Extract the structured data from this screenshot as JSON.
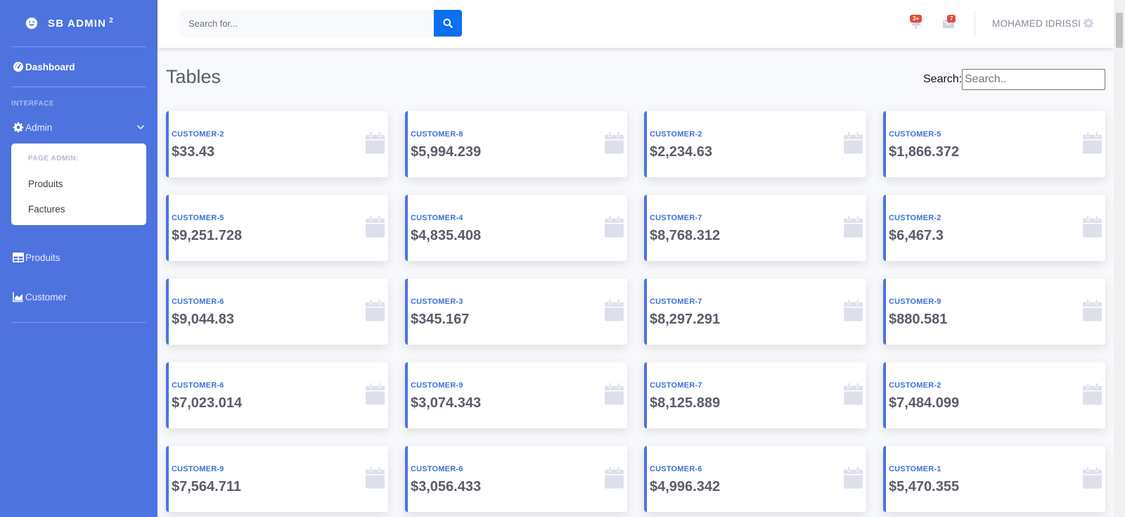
{
  "brand": {
    "title": "SB ADMIN",
    "superscript": "2"
  },
  "sidebar": {
    "dashboard_label": "Dashboard",
    "heading": "INTERFACE",
    "admin_label": "Admin",
    "collapse": {
      "header": "PAGE ADMIN:",
      "items": [
        {
          "label": "Produits"
        },
        {
          "label": "Factures"
        }
      ]
    },
    "produits_label": "Produits",
    "customer_label": "Customer"
  },
  "topbar": {
    "search_placeholder": "Search for...",
    "alerts_badge": "3+",
    "messages_badge": "7",
    "user_name": "MOHAMED IDRISSI"
  },
  "main": {
    "title": "Tables",
    "search_label": "Search:",
    "search_placeholder": "Search..",
    "cards": [
      {
        "label": "CUSTOMER-2",
        "value": "$33.43"
      },
      {
        "label": "CUSTOMER-8",
        "value": "$5,994.239"
      },
      {
        "label": "CUSTOMER-2",
        "value": "$2,234.63"
      },
      {
        "label": "CUSTOMER-5",
        "value": "$1,866.372"
      },
      {
        "label": "CUSTOMER-5",
        "value": "$9,251.728"
      },
      {
        "label": "CUSTOMER-4",
        "value": "$4,835.408"
      },
      {
        "label": "CUSTOMER-7",
        "value": "$8,768.312"
      },
      {
        "label": "CUSTOMER-2",
        "value": "$6,467.3"
      },
      {
        "label": "CUSTOMER-6",
        "value": "$9,044.83"
      },
      {
        "label": "CUSTOMER-3",
        "value": "$345.167"
      },
      {
        "label": "CUSTOMER-7",
        "value": "$8,297.291"
      },
      {
        "label": "CUSTOMER-9",
        "value": "$880.581"
      },
      {
        "label": "CUSTOMER-6",
        "value": "$7,023.014"
      },
      {
        "label": "CUSTOMER-9",
        "value": "$3,074.343"
      },
      {
        "label": "CUSTOMER-7",
        "value": "$8,125.889"
      },
      {
        "label": "CUSTOMER-2",
        "value": "$7,484.099"
      },
      {
        "label": "CUSTOMER-9",
        "value": "$7,564.711"
      },
      {
        "label": "CUSTOMER-6",
        "value": "$3,056.433"
      },
      {
        "label": "CUSTOMER-6",
        "value": "$4,996.342"
      },
      {
        "label": "CUSTOMER-1",
        "value": "$5,470.355"
      }
    ]
  },
  "colors": {
    "sidebar": "#4e73df",
    "accent": "#4e73df",
    "search_button": "#0b6ff0",
    "badge": "#e74a3b",
    "card_label": "#3b72d9"
  },
  "icons": {
    "brand": "laugh-wink-icon",
    "dashboard": "tachometer-icon",
    "admin": "gear-icon",
    "produits": "table-icon",
    "customer": "chart-area-icon",
    "alerts": "bell-icon",
    "messages": "envelope-icon",
    "card": "calendar-icon"
  }
}
